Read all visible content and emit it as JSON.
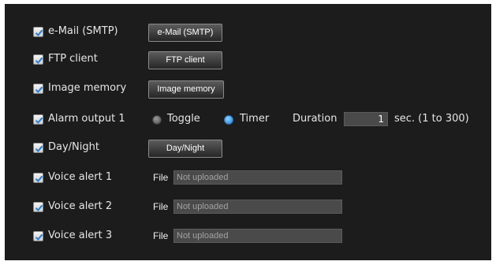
{
  "rows": [
    {
      "label": "e-Mail (SMTP)",
      "checked": true,
      "button": "e-Mail (SMTP)"
    },
    {
      "label": "FTP client",
      "checked": true,
      "button": "FTP client"
    },
    {
      "label": "Image memory",
      "checked": true,
      "button": "Image memory"
    },
    {
      "label": "Alarm output 1",
      "checked": true
    },
    {
      "label": "Day/Night",
      "checked": true,
      "button": "Day/Night"
    },
    {
      "label": "Voice alert 1",
      "checked": true
    },
    {
      "label": "Voice alert 2",
      "checked": true
    },
    {
      "label": "Voice alert 3",
      "checked": true
    }
  ],
  "alarm": {
    "toggle_label": "Toggle",
    "timer_label": "Timer",
    "selected_mode": "Timer",
    "duration_label": "Duration",
    "duration_value": "1",
    "duration_range": "sec. (1 to 300)"
  },
  "voice": {
    "file_label": "File",
    "files": [
      "Not uploaded",
      "Not uploaded",
      "Not uploaded"
    ]
  },
  "colors": {
    "panel_bg": "#1c1c1c",
    "radio_selected": "#1e7fd8"
  },
  "icons": {
    "checkbox": "checkmark-icon"
  }
}
